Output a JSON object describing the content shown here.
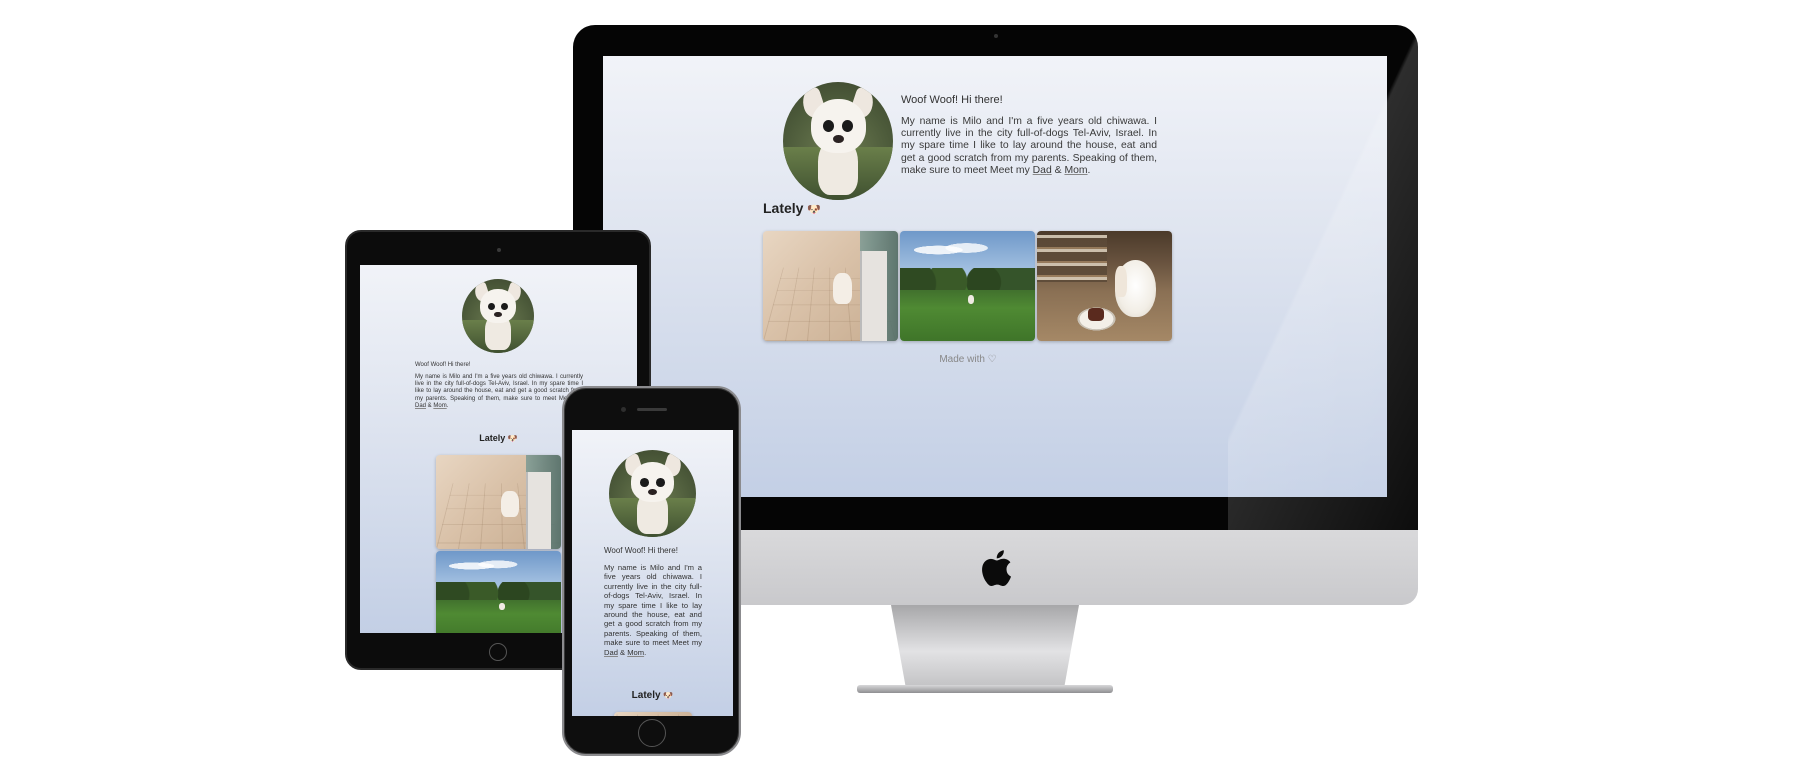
{
  "profile": {
    "greeting": "Woof Woof! Hi there!",
    "bio": "My name is Milo and I'm a five years old chiwawa. I currently live in the city full-of-dogs Tel-Aviv, Israel. In my spare time I like to lay around the house, eat and get a good scratch from my parents. Speaking of them, make sure to meet Meet my ",
    "link_dad": "Dad",
    "link_amp": " & ",
    "link_mom": "Mom",
    "end": "."
  },
  "section": {
    "lately_label": "Lately",
    "lately_icon": "🐶"
  },
  "footer": {
    "made_with": "Made with ♡"
  },
  "photos": [
    "kitchen",
    "park",
    "room"
  ],
  "colors": {
    "screen_top": "#f1f3f8",
    "screen_bottom": "#c3cfe5",
    "bezel": "#050505",
    "chin": "#d0d0d2"
  }
}
